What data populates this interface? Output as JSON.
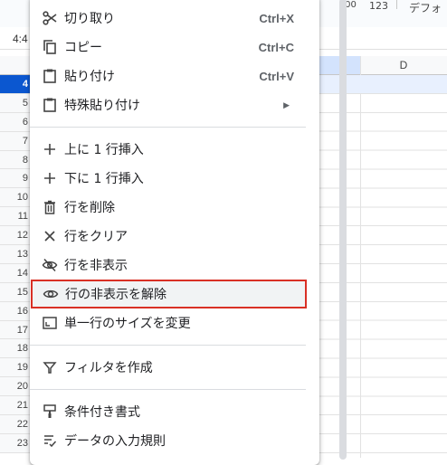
{
  "toolbar": {
    "decimals_label": ".00",
    "number_format": "123",
    "font_partial": "デフォ"
  },
  "cell_ref": "4:4",
  "column_d": "D",
  "rows": [
    "4",
    "5",
    "6",
    "7",
    "8",
    "9",
    "10",
    "11",
    "12",
    "13",
    "14",
    "15",
    "16",
    "17",
    "18",
    "19",
    "20",
    "21",
    "22",
    "23"
  ],
  "menu": {
    "cut": {
      "label": "切り取り",
      "shortcut": "Ctrl+X"
    },
    "copy": {
      "label": "コピー",
      "shortcut": "Ctrl+C"
    },
    "paste": {
      "label": "貼り付け",
      "shortcut": "Ctrl+V"
    },
    "paste_special": {
      "label": "特殊貼り付け"
    },
    "insert_above": {
      "label": "上に 1 行挿入"
    },
    "insert_below": {
      "label": "下に 1 行挿入"
    },
    "delete_row": {
      "label": "行を削除"
    },
    "clear_row": {
      "label": "行をクリア"
    },
    "hide_row": {
      "label": "行を非表示"
    },
    "unhide_row": {
      "label": "行の非表示を解除"
    },
    "resize_row": {
      "label": "単一行のサイズを変更"
    },
    "create_filter": {
      "label": "フィルタを作成"
    },
    "conditional_format": {
      "label": "条件付き書式"
    },
    "data_validation": {
      "label": "データの入力規則"
    }
  },
  "colors": {
    "highlight_border": "#d93025",
    "active_row": "#0b57d0",
    "selected_fill": "#e8f0fe"
  }
}
